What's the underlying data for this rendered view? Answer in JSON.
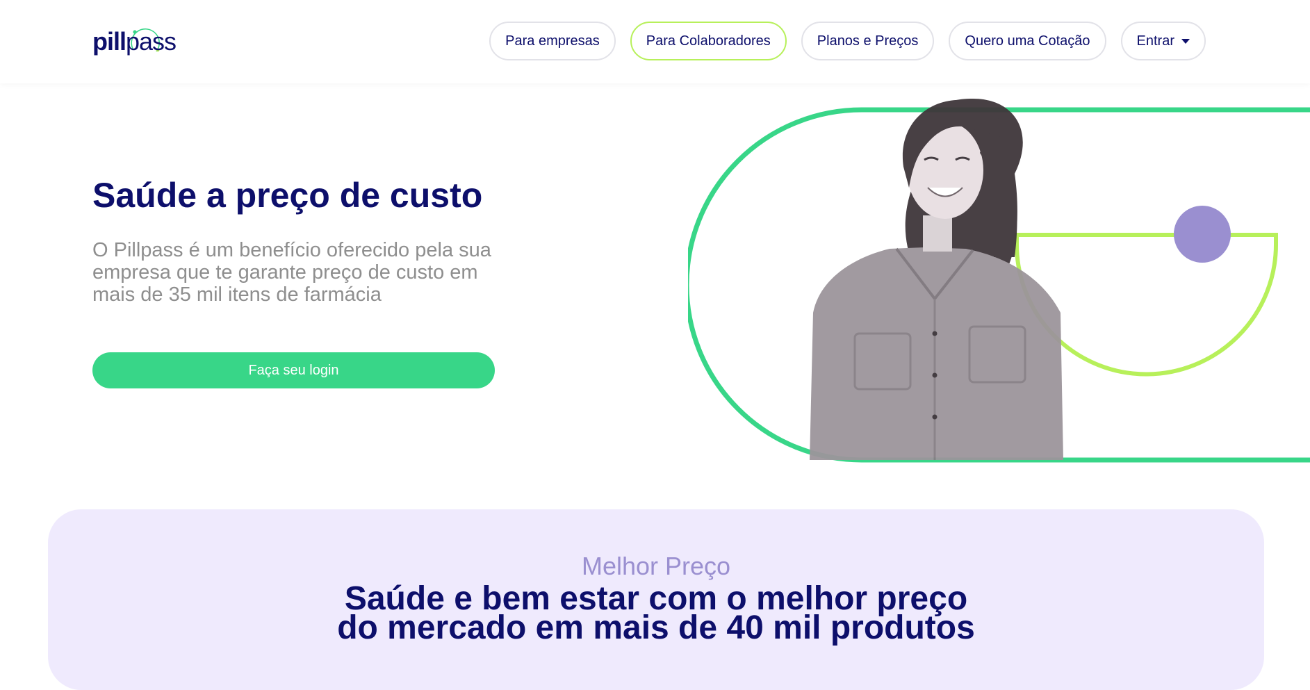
{
  "header": {
    "logo": {
      "pill": "pill",
      "pass": "pass"
    },
    "nav": {
      "empresas": "Para empresas",
      "colaboradores": "Para Colaboradores",
      "planos": "Planos e Preços",
      "cotacao": "Quero uma Cotação",
      "entrar": "Entrar"
    }
  },
  "hero": {
    "title": "Saúde a preço de custo",
    "subtitle": "O Pillpass é um benefício oferecido pela sua empresa que te garante preço de custo em mais de 35 mil itens de farmácia",
    "login_button": "Faça seu login"
  },
  "section": {
    "eyebrow": "Melhor Preço",
    "title_line1": "Saúde e bem estar com o melhor preço",
    "title_line2": "do mercado em mais de 40 mil produtos"
  },
  "colors": {
    "navy": "#0d0f6b",
    "green": "#38d688",
    "lime": "#b7f05a",
    "lavender": "#9a8fd0",
    "section_bg": "#efeafd"
  }
}
